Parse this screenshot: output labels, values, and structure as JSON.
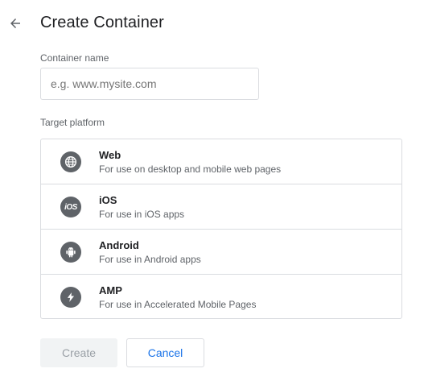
{
  "header": {
    "title": "Create Container"
  },
  "form": {
    "name_label": "Container name",
    "name_placeholder": "e.g. www.mysite.com",
    "name_value": "",
    "platform_label": "Target platform"
  },
  "platforms": [
    {
      "name": "Web",
      "description": "For use on desktop and mobile web pages",
      "icon": "globe-icon"
    },
    {
      "name": "iOS",
      "description": "For use in iOS apps",
      "icon": "ios-icon"
    },
    {
      "name": "Android",
      "description": "For use in Android apps",
      "icon": "android-icon"
    },
    {
      "name": "AMP",
      "description": "For use in Accelerated Mobile Pages",
      "icon": "bolt-icon"
    }
  ],
  "buttons": {
    "create": "Create",
    "cancel": "Cancel"
  },
  "colors": {
    "accent": "#1a73e8",
    "icon_bg": "#5f6368",
    "border": "#dadce0"
  }
}
